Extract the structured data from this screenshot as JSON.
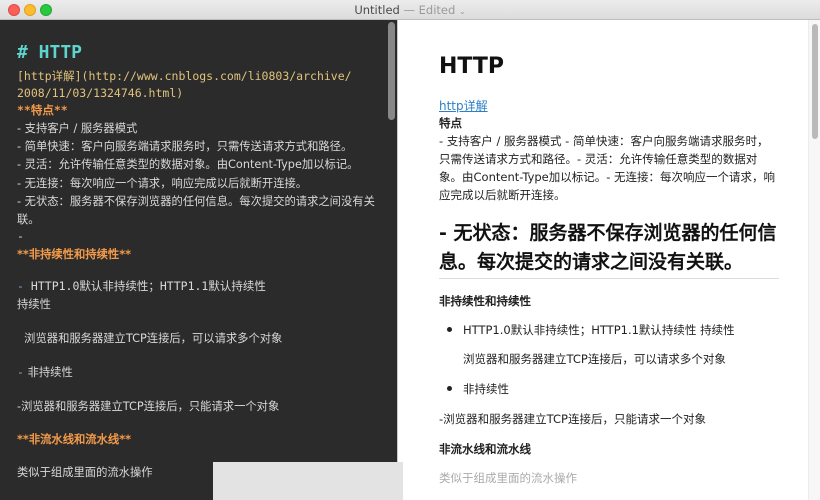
{
  "window": {
    "title": "Untitled",
    "status": "— Edited",
    "chevron": "⌄"
  },
  "editor": {
    "lines": {
      "h1": "# HTTP",
      "link1": "[http详解](http://www.cnblogs.com/li0803/archive/",
      "link2": "2008/11/03/1324746.html)",
      "features": "**特点**",
      "b1": "- 支持客户 / 服务器模式",
      "b2": "- 简单快速：客户向服务端请求服务时，只需传送请求方式和路径。",
      "b3": "- 灵活：允许传输任意类型的数据对象。由Content-Type加以标记。",
      "b4": "- 无连接：每次响应一个请求，响应完成以后就断开连接。",
      "b5a": "- 无状态：服务器不保存浏览器的任何信息。每次提交的请求之间没有关",
      "b5b": "联。",
      "lone_dash": "-",
      "persist": "**非持续性和持续性**",
      "p1_dash": "-",
      "p1": " HTTP1.0默认非持续性；HTTP1.1默认持续性",
      "p1b": "持续性",
      "p2": "  浏览器和服务器建立TCP连接后，可以请求多个对象",
      "p3_dash": "-",
      "p3": " 非持续性",
      "p4": "-浏览器和服务器建立TCP连接后，只能请求一个对象",
      "pipeline": "**非流水线和流水线**",
      "p5": "类似于组成里面的流水操作"
    }
  },
  "preview": {
    "h1": "HTTP",
    "link": "http详解",
    "features": "特点",
    "para": "- 支持客户 / 服务器模式 - 简单快速：客户向服务端请求服务时，只需传送请求方式和路径。- 灵活：允许传输任意类型的数据对象。由Content-Type加以标记。- 无连接：每次响应一个请求，响应完成以后就断开连接。",
    "h2": "- 无状态：服务器不保存浏览器的任何信息。每次提交的请求之间没有关联。",
    "persist": "非持续性和持续性",
    "li1": "HTTP1.0默认非持续性；HTTP1.1默认持续性 持续性",
    "li1_sub": "浏览器和服务器建立TCP连接后，可以请求多个对象",
    "li2": "非持续性",
    "p4": "-浏览器和服务器建立TCP连接后，只能请求一个对象",
    "pipeline": "非流水线和流水线",
    "p5": "类似于组成里面的流水操作"
  }
}
